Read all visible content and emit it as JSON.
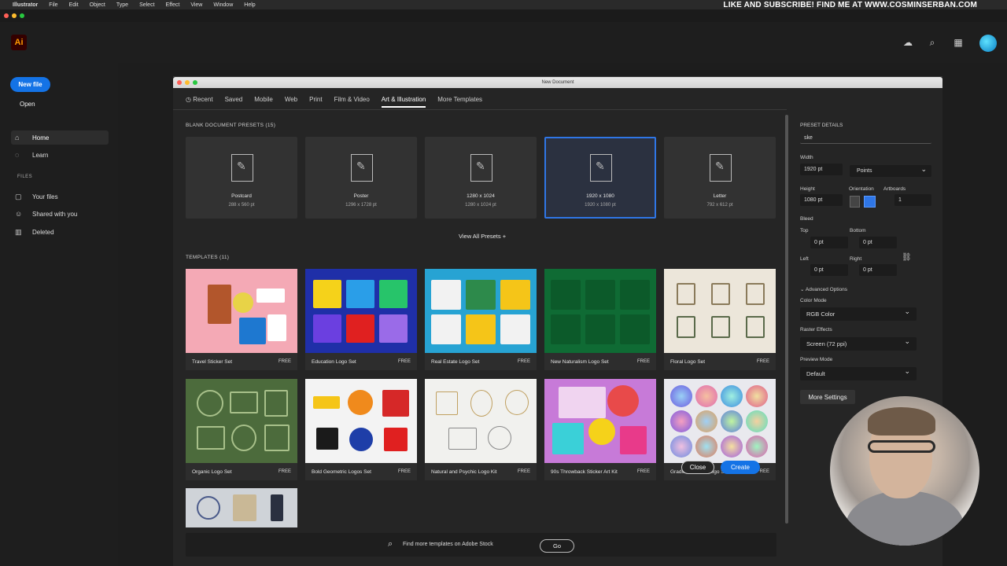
{
  "menubar": {
    "app": "Illustrator",
    "items": [
      "File",
      "Edit",
      "Object",
      "Type",
      "Select",
      "Effect",
      "View",
      "Window",
      "Help"
    ],
    "promo": "LIKE AND SUBSCRIBE! FIND ME AT WWW.COSMINSERBAN.COM"
  },
  "app": {
    "logo": "Ai"
  },
  "sidebar": {
    "new_file": "New file",
    "open": "Open",
    "home": "Home",
    "learn": "Learn",
    "files_header": "FILES",
    "your_files": "Your files",
    "shared": "Shared with you",
    "deleted": "Deleted"
  },
  "dialog": {
    "title": "New Document",
    "tabs": [
      "Recent",
      "Saved",
      "Mobile",
      "Web",
      "Print",
      "Film & Video",
      "Art & Illustration",
      "More Templates"
    ],
    "active_tab": "Art & Illustration",
    "blank_header": "BLANK DOCUMENT PRESETS",
    "blank_count": "(15)",
    "presets": [
      {
        "name": "Postcard",
        "size": "288 x 560 pt"
      },
      {
        "name": "Poster",
        "size": "1296 x 1728 pt"
      },
      {
        "name": "1280 x 1024",
        "size": "1280 x 1024 pt"
      },
      {
        "name": "1920 x 1080",
        "size": "1920 x 1080 pt"
      },
      {
        "name": "Letter",
        "size": "792 x 612 pt"
      }
    ],
    "view_all": "View All Presets +",
    "templates_header": "TEMPLATES",
    "templates_count": "(11)",
    "templates": [
      {
        "name": "Travel Sticker Set",
        "badge": "FREE"
      },
      {
        "name": "Education Logo Set",
        "badge": "FREE"
      },
      {
        "name": "Real Estate Logo Set",
        "badge": "FREE"
      },
      {
        "name": "New Naturalism Logo Set",
        "badge": "FREE"
      },
      {
        "name": "Floral Logo Set",
        "badge": "FREE"
      },
      {
        "name": "Organic Logo Set",
        "badge": "FREE"
      },
      {
        "name": "Bold Geometric Logos Set",
        "badge": "FREE"
      },
      {
        "name": "Natural and Psychic Logo Kit",
        "badge": "FREE"
      },
      {
        "name": "90s Throwback Sticker Art Kit",
        "badge": "FREE"
      },
      {
        "name": "Gradient Zodiac Logo Set",
        "badge": "FREE"
      }
    ],
    "find_more": "Find more templates on Adobe Stock",
    "go": "Go"
  },
  "preset_details": {
    "header": "PRESET DETAILS",
    "name_value": "ske",
    "width_label": "Width",
    "width_value": "1920 pt",
    "units": "Points",
    "height_label": "Height",
    "height_value": "1080 pt",
    "orientation_label": "Orientation",
    "artboards_label": "Artboards",
    "artboards_value": "1",
    "bleed_label": "Bleed",
    "top_label": "Top",
    "top_value": "0 pt",
    "bottom_label": "Bottom",
    "bottom_value": "0 pt",
    "left_label": "Left",
    "left_value": "0 pt",
    "right_label": "Right",
    "right_value": "0 pt",
    "advanced": "Advanced Options",
    "color_mode_label": "Color Mode",
    "color_mode": "RGB Color",
    "raster_label": "Raster Effects",
    "raster": "Screen (72 ppi)",
    "preview_label": "Preview Mode",
    "preview": "Default",
    "more_settings": "More Settings",
    "close": "Close",
    "create": "Create"
  },
  "colors": {
    "accent": "#1473e6",
    "selection": "#2f76e6"
  }
}
